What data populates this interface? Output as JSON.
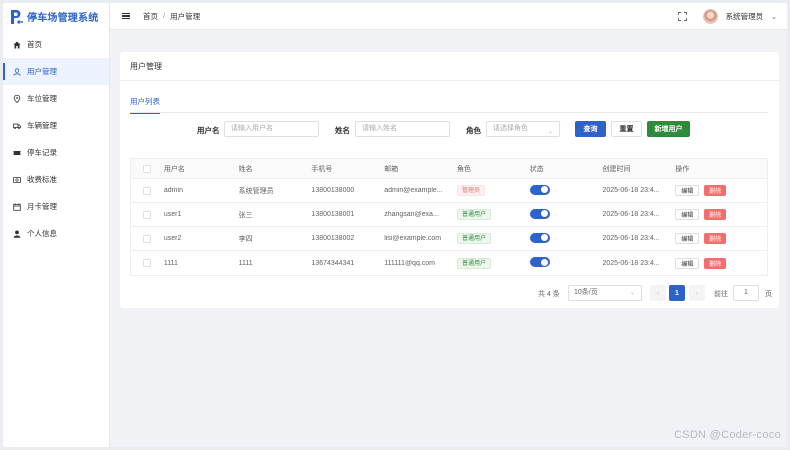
{
  "app": {
    "title": "停车场管理系统",
    "brand_color": "#2d62c8"
  },
  "sidebar": {
    "items": [
      {
        "label": "首页",
        "icon": "home-icon",
        "active": false
      },
      {
        "label": "用户管理",
        "icon": "user-icon",
        "active": true
      },
      {
        "label": "车位管理",
        "icon": "location-icon",
        "active": false
      },
      {
        "label": "车辆管理",
        "icon": "truck-icon",
        "active": false
      },
      {
        "label": "停车记录",
        "icon": "ticket-icon",
        "active": false
      },
      {
        "label": "收费标准",
        "icon": "money-icon",
        "active": false
      },
      {
        "label": "月卡管理",
        "icon": "calendar-icon",
        "active": false
      },
      {
        "label": "个人信息",
        "icon": "person-icon",
        "active": false
      }
    ]
  },
  "header": {
    "breadcrumb": [
      "首页",
      "用户管理"
    ],
    "breadcrumb_sep": "/",
    "username": "系统管理员",
    "chevron": "⌄"
  },
  "card": {
    "title": "用户管理",
    "tab": "用户列表"
  },
  "search": {
    "username_label": "用户名",
    "username_placeholder": "请输入用户名",
    "name_label": "姓名",
    "name_placeholder": "请输入姓名",
    "role_label": "角色",
    "role_placeholder": "请选择角色",
    "query_button": "查询",
    "reset_button": "重置",
    "add_button": "新增用户"
  },
  "table": {
    "headers": [
      "用户名",
      "姓名",
      "手机号",
      "邮箱",
      "角色",
      "状态",
      "创建时间",
      "操作"
    ],
    "rows": [
      {
        "username": "admin",
        "name": "系统管理员",
        "phone": "13800138000",
        "email": "admin@example...",
        "role": "管理员",
        "role_type": "admin",
        "enabled": true,
        "created": "2025-06-18 23:4..."
      },
      {
        "username": "user1",
        "name": "张三",
        "phone": "13800138001",
        "email": "zhangsan@exa...",
        "role": "普通用户",
        "role_type": "user",
        "enabled": true,
        "created": "2025-06-18 23:4..."
      },
      {
        "username": "user2",
        "name": "李四",
        "phone": "13800138002",
        "email": "lisi@example.com",
        "role": "普通用户",
        "role_type": "user",
        "enabled": true,
        "created": "2025-06-18 23:4..."
      },
      {
        "username": "1111",
        "name": "1111",
        "phone": "13674344341",
        "email": "111111@qq.com",
        "role": "普通用户",
        "role_type": "user",
        "enabled": true,
        "created": "2025-06-18 23:4..."
      }
    ],
    "edit_label": "编辑",
    "delete_label": "删除"
  },
  "pagination": {
    "total": "共 4 条",
    "page_size": "10条/页",
    "current_page": "1",
    "goto_label": "前往",
    "goto_value": "1",
    "page_suffix": "页",
    "prev": "‹",
    "next": "›"
  },
  "watermark": "CSDN @Coder-coco"
}
